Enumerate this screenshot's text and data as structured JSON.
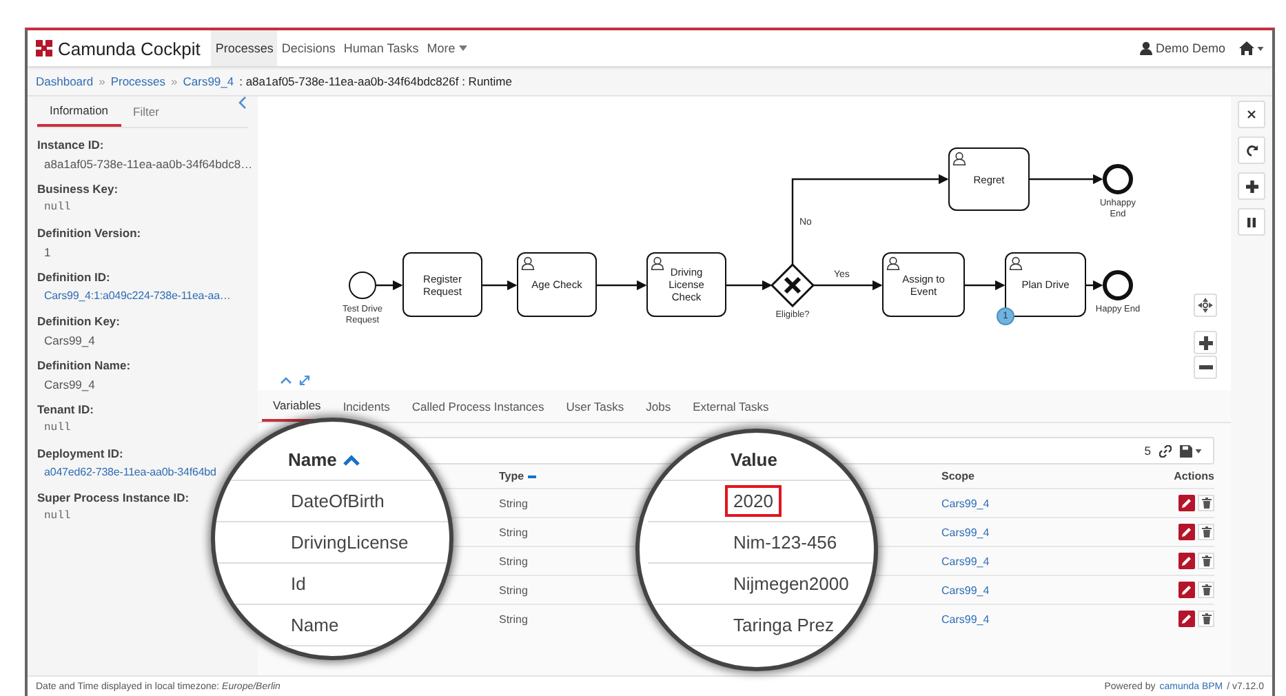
{
  "navbar": {
    "brand": "Camunda Cockpit",
    "items": [
      {
        "label": "Processes",
        "selected": true,
        "kind": "link"
      },
      {
        "label": "Decisions",
        "selected": false,
        "kind": "link"
      },
      {
        "label": "Human Tasks",
        "selected": false,
        "kind": "link"
      },
      {
        "label": "More",
        "selected": false,
        "kind": "dropdown"
      }
    ],
    "user": "Demo Demo"
  },
  "breadcrumb": {
    "separator": "»",
    "links": [
      "Dashboard",
      "Processes",
      "Cars99_4"
    ],
    "current": ": a8a1af05-738e-11ea-aa0b-34f64bdc826f : Runtime"
  },
  "sidebar": {
    "tabs": [
      {
        "label": "Information",
        "selected": true
      },
      {
        "label": "Filter",
        "selected": false
      }
    ],
    "fields": [
      {
        "label": "Instance ID:",
        "value": "a8a1af05-738e-11ea-aa0b-34f64bdc8…",
        "kind": "text"
      },
      {
        "label": "Business Key:",
        "value": "null",
        "kind": "null"
      },
      {
        "label": "Definition Version:",
        "value": "1",
        "kind": "text"
      },
      {
        "label": "Definition ID:",
        "value": "Cars99_4:1:a049c224-738e-11ea-aa…",
        "kind": "link"
      },
      {
        "label": "Definition Key:",
        "value": "Cars99_4",
        "kind": "text"
      },
      {
        "label": "Definition Name:",
        "value": "Cars99_4",
        "kind": "text"
      },
      {
        "label": "Tenant ID:",
        "value": "null",
        "kind": "null"
      },
      {
        "label": "Deployment ID:",
        "value": "a047ed62-738e-11ea-aa0b-34f64bd",
        "kind": "link"
      },
      {
        "label": "Super Process Instance ID:",
        "value": "null",
        "kind": "null"
      }
    ]
  },
  "diagram": {
    "nodes": [
      {
        "kind": "start",
        "label": "Test Drive Request"
      },
      {
        "kind": "task",
        "label": "Register Request"
      },
      {
        "kind": "user-task",
        "label": "Age Check"
      },
      {
        "kind": "user-task",
        "label": "Driving License Check"
      },
      {
        "kind": "gateway",
        "label": "Eligible?"
      },
      {
        "kind": "user-task",
        "label": "Regret"
      },
      {
        "kind": "end",
        "label": "Unhappy End"
      },
      {
        "kind": "user-task",
        "label": "Assign to Event"
      },
      {
        "kind": "user-task",
        "label": "Plan Drive",
        "badge": "1"
      },
      {
        "kind": "end",
        "label": "Happy End"
      }
    ],
    "flow_labels": [
      "No",
      "Yes"
    ]
  },
  "tabs": [
    {
      "label": "Variables",
      "selected": true
    },
    {
      "label": "Incidents",
      "selected": false
    },
    {
      "label": "Called Process Instances",
      "selected": false
    },
    {
      "label": "User Tasks",
      "selected": false
    },
    {
      "label": "Jobs",
      "selected": false
    },
    {
      "label": "External Tasks",
      "selected": false
    }
  ],
  "table": {
    "count": "5",
    "columns": {
      "type": "Type",
      "scope": "Scope",
      "actions": "Actions"
    },
    "rows": [
      {
        "type": "String",
        "scope": "Cars99_4"
      },
      {
        "type": "String",
        "scope": "Cars99_4"
      },
      {
        "type": "String",
        "scope": "Cars99_4"
      },
      {
        "type": "String",
        "scope": "Cars99_4"
      },
      {
        "type": "String",
        "scope": "Cars99_4"
      }
    ]
  },
  "magnifiers": [
    {
      "header": "Name",
      "sorted": true,
      "items": [
        {
          "text": "DateOfBirth",
          "highlighted": false
        },
        {
          "text": "DrivingLicense",
          "highlighted": false
        },
        {
          "text": "Id",
          "highlighted": false
        },
        {
          "text": "Name",
          "highlighted": false
        }
      ]
    },
    {
      "header": "Value",
      "sorted": false,
      "items": [
        {
          "text": "2020",
          "highlighted": true
        },
        {
          "text": "Nim-123-456",
          "highlighted": false
        },
        {
          "text": "Nijmegen2000",
          "highlighted": false
        },
        {
          "text": "Taringa Prez",
          "highlighted": false
        }
      ]
    }
  ],
  "footer": {
    "timezone": "Date and Time displayed in local timezone: *Europe/Berlin*",
    "powered": "Powered by",
    "link": "camunda BPM",
    "version": "/ v7.12.0"
  }
}
